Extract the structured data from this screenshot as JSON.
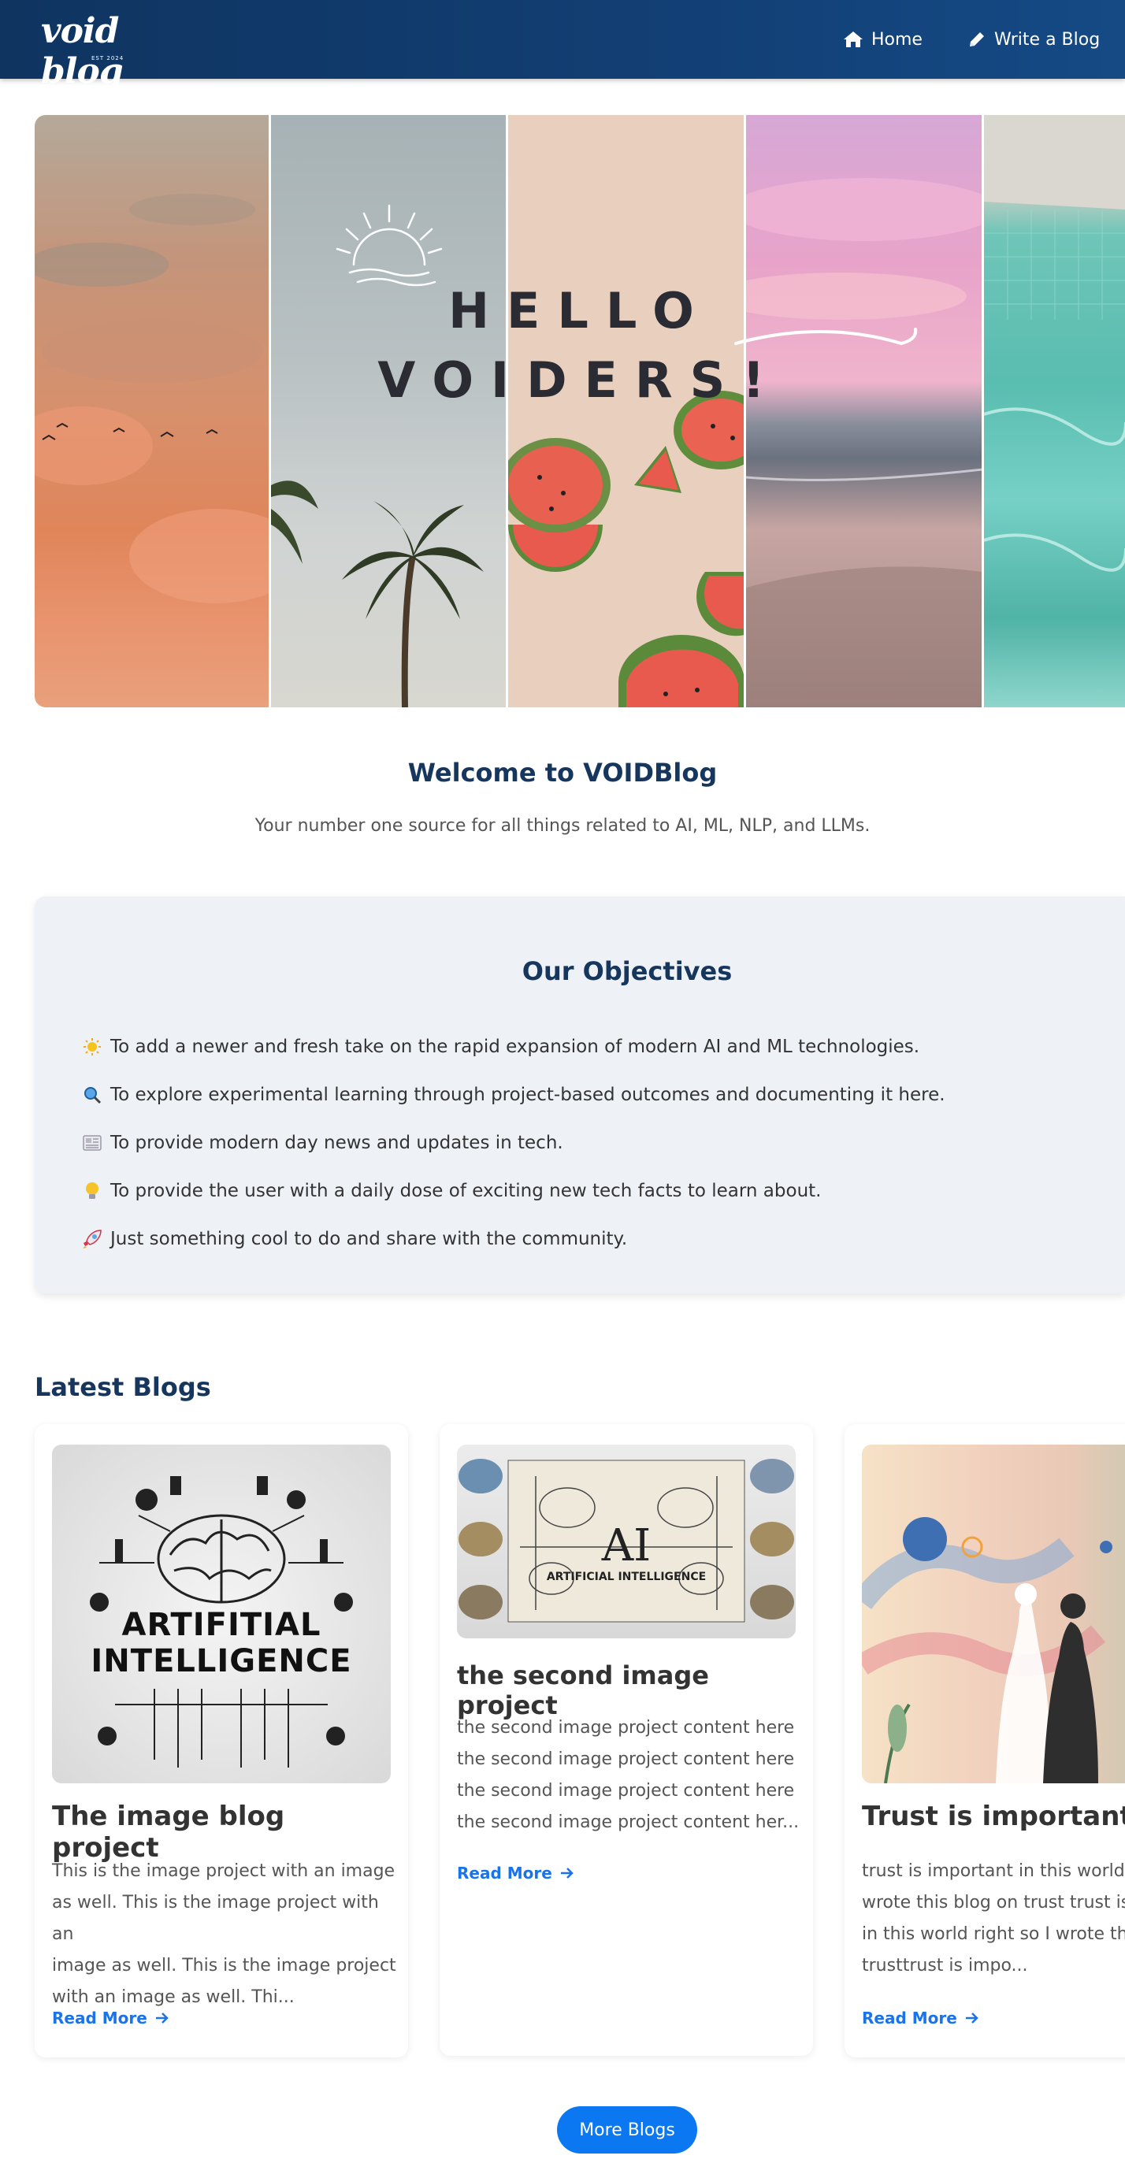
{
  "nav": {
    "logo_text": "void blog",
    "logo_sub": "EST 2024",
    "home_label": "Home",
    "write_label": "Write a Blog"
  },
  "hero": {
    "line1": "HELLO",
    "line2": "VOIDERS!"
  },
  "welcome": {
    "title": "Welcome to VOIDBlog",
    "subtitle": "Your number one source for all things related to AI, ML, NLP, and LLMs."
  },
  "objectives": {
    "title": "Our Objectives",
    "items": [
      {
        "icon": "sun-icon",
        "text": "To add a newer and fresh take on the rapid expansion of modern AI and ML technologies."
      },
      {
        "icon": "magnifier-icon",
        "text": "To explore experimental learning through project-based outcomes and documenting it here."
      },
      {
        "icon": "newspaper-icon",
        "text": "To provide modern day news and updates in tech."
      },
      {
        "icon": "lightbulb-icon",
        "text": "To provide the user with a daily dose of exciting new tech facts to learn about."
      },
      {
        "icon": "rocket-icon",
        "text": "Just something cool to do and share with the community."
      }
    ]
  },
  "latest": {
    "title": "Latest Blogs",
    "cards": [
      {
        "image_text_1": "ARTIFITIAL",
        "image_text_2": "INTELLIGENCE",
        "title": "The image blog project",
        "lines": [
          "This is the image project with an image",
          "as well. This is the image project with an",
          "image as well. This is the image project",
          "with an image as well. Thi..."
        ],
        "read_more": "Read More"
      },
      {
        "image_text_1": "AI",
        "image_text_2": "ARTIFICIAL INTELLIGENCE",
        "title": "the second image project",
        "lines": [
          "the second image project content here",
          "the second image project content here",
          "the second image project content here",
          "the second image project content her..."
        ],
        "read_more": "Read More"
      },
      {
        "title": "Trust is important",
        "lines": [
          "trust is important in this world rig",
          "wrote this blog on trust trust is im",
          "in this world right so I wrote this b",
          "trusttrust is impo..."
        ],
        "read_more": "Read More"
      }
    ]
  },
  "more_button": "More Blogs",
  "colors": {
    "nav": "#0f3460",
    "heading": "#16365e",
    "link": "#1a73e8",
    "button": "#0b78f2"
  }
}
